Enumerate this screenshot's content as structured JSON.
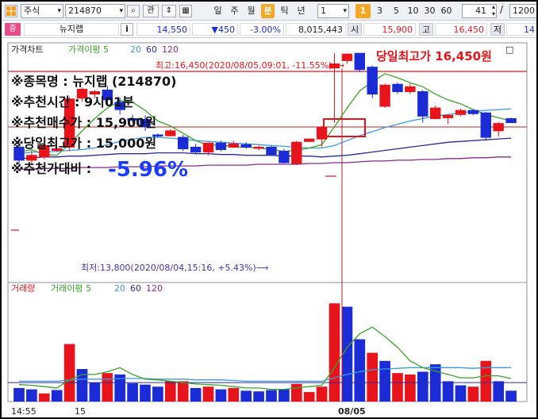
{
  "toolbar": {
    "market_select": "주식",
    "code_input": "214870",
    "search_icon": "search-icon",
    "tab_related": "관",
    "stepper_icon": "updown-icon",
    "grid_icon": "grid-icon",
    "periods": [
      "일",
      "주",
      "월",
      "분",
      "틱",
      "년"
    ],
    "active_period": "분",
    "interval_select": "1",
    "minute_buttons": [
      "1",
      "3",
      "5",
      "10",
      "30",
      "60"
    ],
    "active_minute": "1",
    "count_value": "41",
    "slash": "/",
    "total_value": "1200"
  },
  "quote": {
    "market_badge": "증",
    "name": "뉴지랩",
    "info_button": "i",
    "price": "14,550",
    "change": "▼450",
    "change_pct": "-3.00%",
    "volume": "8,015,443",
    "open_label": "시",
    "open": "15,900",
    "high_label": "고",
    "high": "16,450",
    "low_label": "저",
    "low": "14"
  },
  "price_panel": {
    "legend_title": "가격차트",
    "ma_label": "가격이평",
    "ma_values": [
      "5",
      "20",
      "60",
      "120"
    ],
    "ma_colors": [
      "#3aa329",
      "#3b9ae1",
      "#2e2aa0",
      "#8a2a8a"
    ],
    "high_marker": "최고:16,450(2020/08/05,09:01, -11.55%)⟶",
    "low_marker": "최저:13,800(2020/08/04,15:16, +5.43%)⟶",
    "red_title": "당일최고가 16,450원",
    "info_lines": [
      "※종목명 : 뉴지랩 (214870)",
      "※추천시간 : 9시01분",
      "※추천매수가 : 15,900원",
      "※당일최고가 : 15,000원"
    ],
    "compare_label": "※추천가대비 :",
    "compare_value": "-5.96%"
  },
  "volume_panel": {
    "legend_title": "거래량",
    "ma_label": "거래이평",
    "ma_values": [
      "5",
      "20",
      "60",
      "120"
    ]
  },
  "x_axis": {
    "labels": [
      "14:55",
      "15",
      "08/05"
    ]
  },
  "colors": {
    "up": "#e8141b",
    "down": "#1b2cd6",
    "blue_value": "#1a3cff",
    "red_text": "#e8141b"
  },
  "chart_data": {
    "type": "candlestick",
    "candles": [
      {
        "o": 15300,
        "h": 15380,
        "l": 15090,
        "c": 15140
      },
      {
        "o": 15140,
        "h": 15260,
        "l": 15080,
        "c": 15200
      },
      {
        "o": 15180,
        "h": 15350,
        "l": 15150,
        "c": 15320
      },
      {
        "o": 15260,
        "h": 15300,
        "l": 15240,
        "c": 15280
      },
      {
        "o": 15300,
        "h": 15920,
        "l": 15250,
        "c": 15890
      },
      {
        "o": 15900,
        "h": 16030,
        "l": 15860,
        "c": 16010
      },
      {
        "o": 15950,
        "h": 16000,
        "l": 15900,
        "c": 15980
      },
      {
        "o": 16000,
        "h": 16050,
        "l": 15820,
        "c": 15880
      },
      {
        "o": 15850,
        "h": 15900,
        "l": 15700,
        "c": 15760
      },
      {
        "o": 15650,
        "h": 15700,
        "l": 15600,
        "c": 15630
      },
      {
        "o": 15640,
        "h": 15690,
        "l": 15500,
        "c": 15550
      },
      {
        "o": 15450,
        "h": 15470,
        "l": 15420,
        "c": 15440
      },
      {
        "o": 15440,
        "h": 15520,
        "l": 15430,
        "c": 15500
      },
      {
        "o": 15420,
        "h": 15450,
        "l": 15250,
        "c": 15280
      },
      {
        "o": 15300,
        "h": 15340,
        "l": 15220,
        "c": 15240
      },
      {
        "o": 15240,
        "h": 15360,
        "l": 15200,
        "c": 15350
      },
      {
        "o": 15350,
        "h": 15380,
        "l": 15250,
        "c": 15270
      },
      {
        "o": 15300,
        "h": 15380,
        "l": 15290,
        "c": 15340
      },
      {
        "o": 15330,
        "h": 15360,
        "l": 15280,
        "c": 15300
      },
      {
        "o": 15290,
        "h": 15320,
        "l": 15260,
        "c": 15300
      },
      {
        "o": 15300,
        "h": 15320,
        "l": 15200,
        "c": 15210
      },
      {
        "o": 15250,
        "h": 15280,
        "l": 15100,
        "c": 15110
      },
      {
        "o": 15100,
        "h": 15380,
        "l": 15080,
        "c": 15360
      },
      {
        "o": 15370,
        "h": 15400,
        "l": 15360,
        "c": 15400
      },
      {
        "o": 15400,
        "h": 15560,
        "l": 15300,
        "c": 15540
      },
      {
        "o": 16270,
        "h": 16450,
        "l": 15600,
        "c": 16320
      },
      {
        "o": 16360,
        "h": 16450,
        "l": 16320,
        "c": 16440
      },
      {
        "o": 16450,
        "h": 16450,
        "l": 16220,
        "c": 16250
      },
      {
        "o": 16280,
        "h": 16300,
        "l": 15900,
        "c": 15950
      },
      {
        "o": 15800,
        "h": 16080,
        "l": 15780,
        "c": 16060
      },
      {
        "o": 16070,
        "h": 16090,
        "l": 15950,
        "c": 15980
      },
      {
        "o": 15980,
        "h": 16080,
        "l": 15950,
        "c": 16040
      },
      {
        "o": 15980,
        "h": 16000,
        "l": 15600,
        "c": 15680
      },
      {
        "o": 15650,
        "h": 15810,
        "l": 15640,
        "c": 15780
      },
      {
        "o": 15660,
        "h": 15700,
        "l": 15580,
        "c": 15690
      },
      {
        "o": 15700,
        "h": 15770,
        "l": 15680,
        "c": 15750
      },
      {
        "o": 15750,
        "h": 15760,
        "l": 15690,
        "c": 15710
      },
      {
        "o": 15720,
        "h": 15730,
        "l": 15380,
        "c": 15420
      },
      {
        "o": 15500,
        "h": 15610,
        "l": 15430,
        "c": 15590
      },
      {
        "o": 15650,
        "h": 15660,
        "l": 15620,
        "c": 15600
      }
    ],
    "ma5": [
      15240,
      15270,
      15210,
      15200,
      15340,
      15500,
      15650,
      15780,
      15870,
      15850,
      15750,
      15620,
      15560,
      15470,
      15380,
      15320,
      15330,
      15300,
      15300,
      15290,
      15270,
      15250,
      15260,
      15290,
      15330,
      15550,
      15780,
      15990,
      16100,
      16200,
      16150,
      16090,
      16040,
      15950,
      15880,
      15830,
      15760,
      15700,
      15660,
      15620
    ],
    "ma20": [
      15220,
      15240,
      15240,
      15250,
      15260,
      15270,
      15290,
      15330,
      15370,
      15400,
      15420,
      15420,
      15410,
      15400,
      15380,
      15370,
      15360,
      15350,
      15340,
      15330,
      15320,
      15310,
      15300,
      15290,
      15290,
      15320,
      15380,
      15440,
      15490,
      15540,
      15580,
      15620,
      15650,
      15680,
      15700,
      15720,
      15740,
      15750,
      15760,
      15770
    ],
    "ma60": [
      15160,
      15170,
      15180,
      15180,
      15190,
      15190,
      15200,
      15210,
      15220,
      15220,
      15220,
      15230,
      15230,
      15230,
      15220,
      15220,
      15210,
      15210,
      15200,
      15200,
      15200,
      15190,
      15190,
      15190,
      15180,
      15190,
      15200,
      15220,
      15240,
      15260,
      15280,
      15300,
      15320,
      15340,
      15360,
      15370,
      15380,
      15390,
      15400,
      15410
    ],
    "ma120": [
      15030,
      15030,
      15040,
      15040,
      15040,
      15050,
      15050,
      15050,
      15060,
      15060,
      15060,
      15070,
      15070,
      15070,
      15070,
      15080,
      15080,
      15080,
      15080,
      15090,
      15090,
      15090,
      15090,
      15100,
      15100,
      15110,
      15110,
      15120,
      15130,
      15130,
      15140,
      15140,
      15150,
      15150,
      15160,
      15160,
      15170,
      15170,
      15180,
      15180
    ],
    "volumes": [
      {
        "v": 20,
        "up": false
      },
      {
        "v": 18,
        "up": false
      },
      {
        "v": 12,
        "up": true
      },
      {
        "v": 17,
        "up": false
      },
      {
        "v": 85,
        "up": true
      },
      {
        "v": 48,
        "up": false
      },
      {
        "v": 28,
        "up": false
      },
      {
        "v": 42,
        "up": true
      },
      {
        "v": 40,
        "up": false
      },
      {
        "v": 27,
        "up": false
      },
      {
        "v": 25,
        "up": false
      },
      {
        "v": 22,
        "up": false
      },
      {
        "v": 30,
        "up": true
      },
      {
        "v": 30,
        "up": true
      },
      {
        "v": 20,
        "up": false
      },
      {
        "v": 22,
        "up": true
      },
      {
        "v": 18,
        "up": false
      },
      {
        "v": 20,
        "up": true
      },
      {
        "v": 16,
        "up": false
      },
      {
        "v": 15,
        "up": false
      },
      {
        "v": 17,
        "up": false
      },
      {
        "v": 18,
        "up": false
      },
      {
        "v": 26,
        "up": true
      },
      {
        "v": 14,
        "up": true
      },
      {
        "v": 22,
        "up": true
      },
      {
        "v": 145,
        "up": true
      },
      {
        "v": 140,
        "up": false
      },
      {
        "v": 92,
        "up": false
      },
      {
        "v": 72,
        "up": true
      },
      {
        "v": 60,
        "up": false
      },
      {
        "v": 42,
        "up": true
      },
      {
        "v": 40,
        "up": true
      },
      {
        "v": 44,
        "up": false
      },
      {
        "v": 55,
        "up": false
      },
      {
        "v": 30,
        "up": false
      },
      {
        "v": 24,
        "up": false
      },
      {
        "v": 22,
        "up": true
      },
      {
        "v": 60,
        "up": true
      },
      {
        "v": 30,
        "up": false
      },
      {
        "v": 16,
        "up": false
      }
    ],
    "vol_ma5": [
      25,
      24,
      22,
      20,
      32,
      40,
      40,
      44,
      50,
      40,
      33,
      32,
      30,
      28,
      26,
      25,
      24,
      22,
      20,
      20,
      18,
      18,
      20,
      22,
      24,
      50,
      80,
      100,
      110,
      96,
      80,
      60,
      50,
      45,
      40,
      35,
      35,
      38,
      38,
      34
    ],
    "vol_ma20": [
      30,
      30,
      30,
      30,
      32,
      33,
      33,
      33,
      34,
      34,
      34,
      33,
      33,
      33,
      32,
      32,
      32,
      31,
      30,
      30,
      30,
      30,
      30,
      30,
      30,
      35,
      40,
      44,
      47,
      48,
      49,
      50,
      50,
      50,
      50,
      50,
      49,
      50,
      50,
      50
    ],
    "price_range": [
      13700,
      16500
    ],
    "vol_range": [
      0,
      150
    ]
  }
}
